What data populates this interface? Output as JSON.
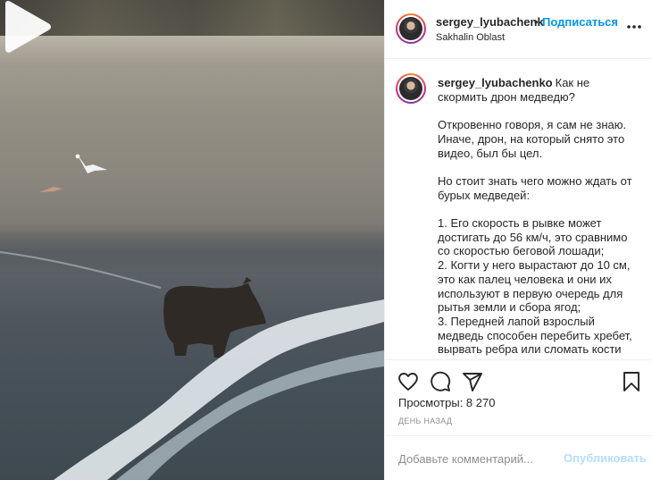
{
  "post": {
    "username": "sergey_lyubachenko",
    "username_truncated": "sergey_lyubachenk",
    "separator": "•",
    "follow_label": "Подписаться",
    "location": "Sakhalin Oblast",
    "caption": "Как не скормить дрон медведю?\n\nОткровенно говоря, я сам не знаю. Иначе, дрон, на который снято это видео, был бы цел.\n\nНо стоит знать чего можно ждать от бурых медведей:\n\n1. Его скорость в рывке может достигать до 56 км/ч, это сравнимо со скоростью беговой лошади;\n2. Когти у него вырастают до 10 см, это как палец человека и они их используют в первую очередь для рытья земли и сбора ягод;\n3. Передней лапой взрослый медведь способен перебить хребет, вырвать ребра или сломать кости",
    "views_label": "Просмотры: 8 270",
    "time_label": "ДЕНЬ НАЗАД"
  },
  "media": {
    "type": "video",
    "icon": "play-icon"
  },
  "actions": {
    "like_icon": "heart-icon",
    "comment_icon": "comment-icon",
    "share_icon": "send-icon",
    "save_icon": "bookmark-icon",
    "more_icon": "more-horizontal-icon"
  },
  "comment": {
    "placeholder": "Добавьте комментарий...",
    "post_label": "Опубликовать"
  },
  "colors": {
    "accent": "#0095f6",
    "accent_disabled": "#b2dffc",
    "text": "#262626",
    "muted": "#8e8e8e",
    "border": "#efefef"
  }
}
